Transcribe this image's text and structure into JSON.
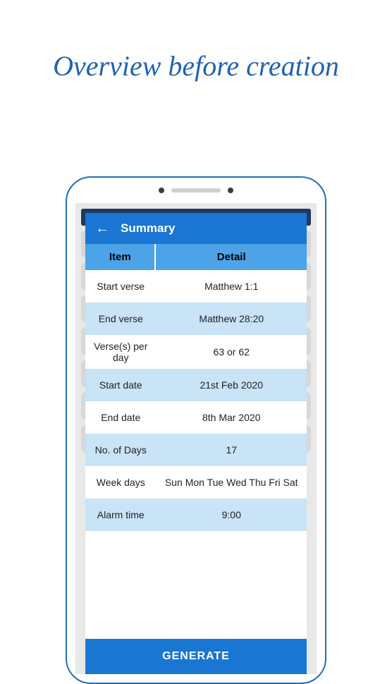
{
  "heading": "Overview before creation",
  "appbar": {
    "title": "Summary"
  },
  "table": {
    "header_item": "Item",
    "header_detail": "Detail",
    "rows": [
      {
        "item": "Start verse",
        "detail": "Matthew 1:1"
      },
      {
        "item": "End verse",
        "detail": "Matthew 28:20"
      },
      {
        "item": "Verse(s) per day",
        "detail": "63 or 62"
      },
      {
        "item": "Start date",
        "detail": "21st Feb 2020"
      },
      {
        "item": "End date",
        "detail": "8th Mar 2020"
      },
      {
        "item": "No. of Days",
        "detail": "17"
      },
      {
        "item": "Week days",
        "detail": "Sun Mon Tue Wed Thu Fri Sat"
      },
      {
        "item": "Alarm time",
        "detail": "9:00"
      }
    ]
  },
  "generate_label": "GENERATE"
}
